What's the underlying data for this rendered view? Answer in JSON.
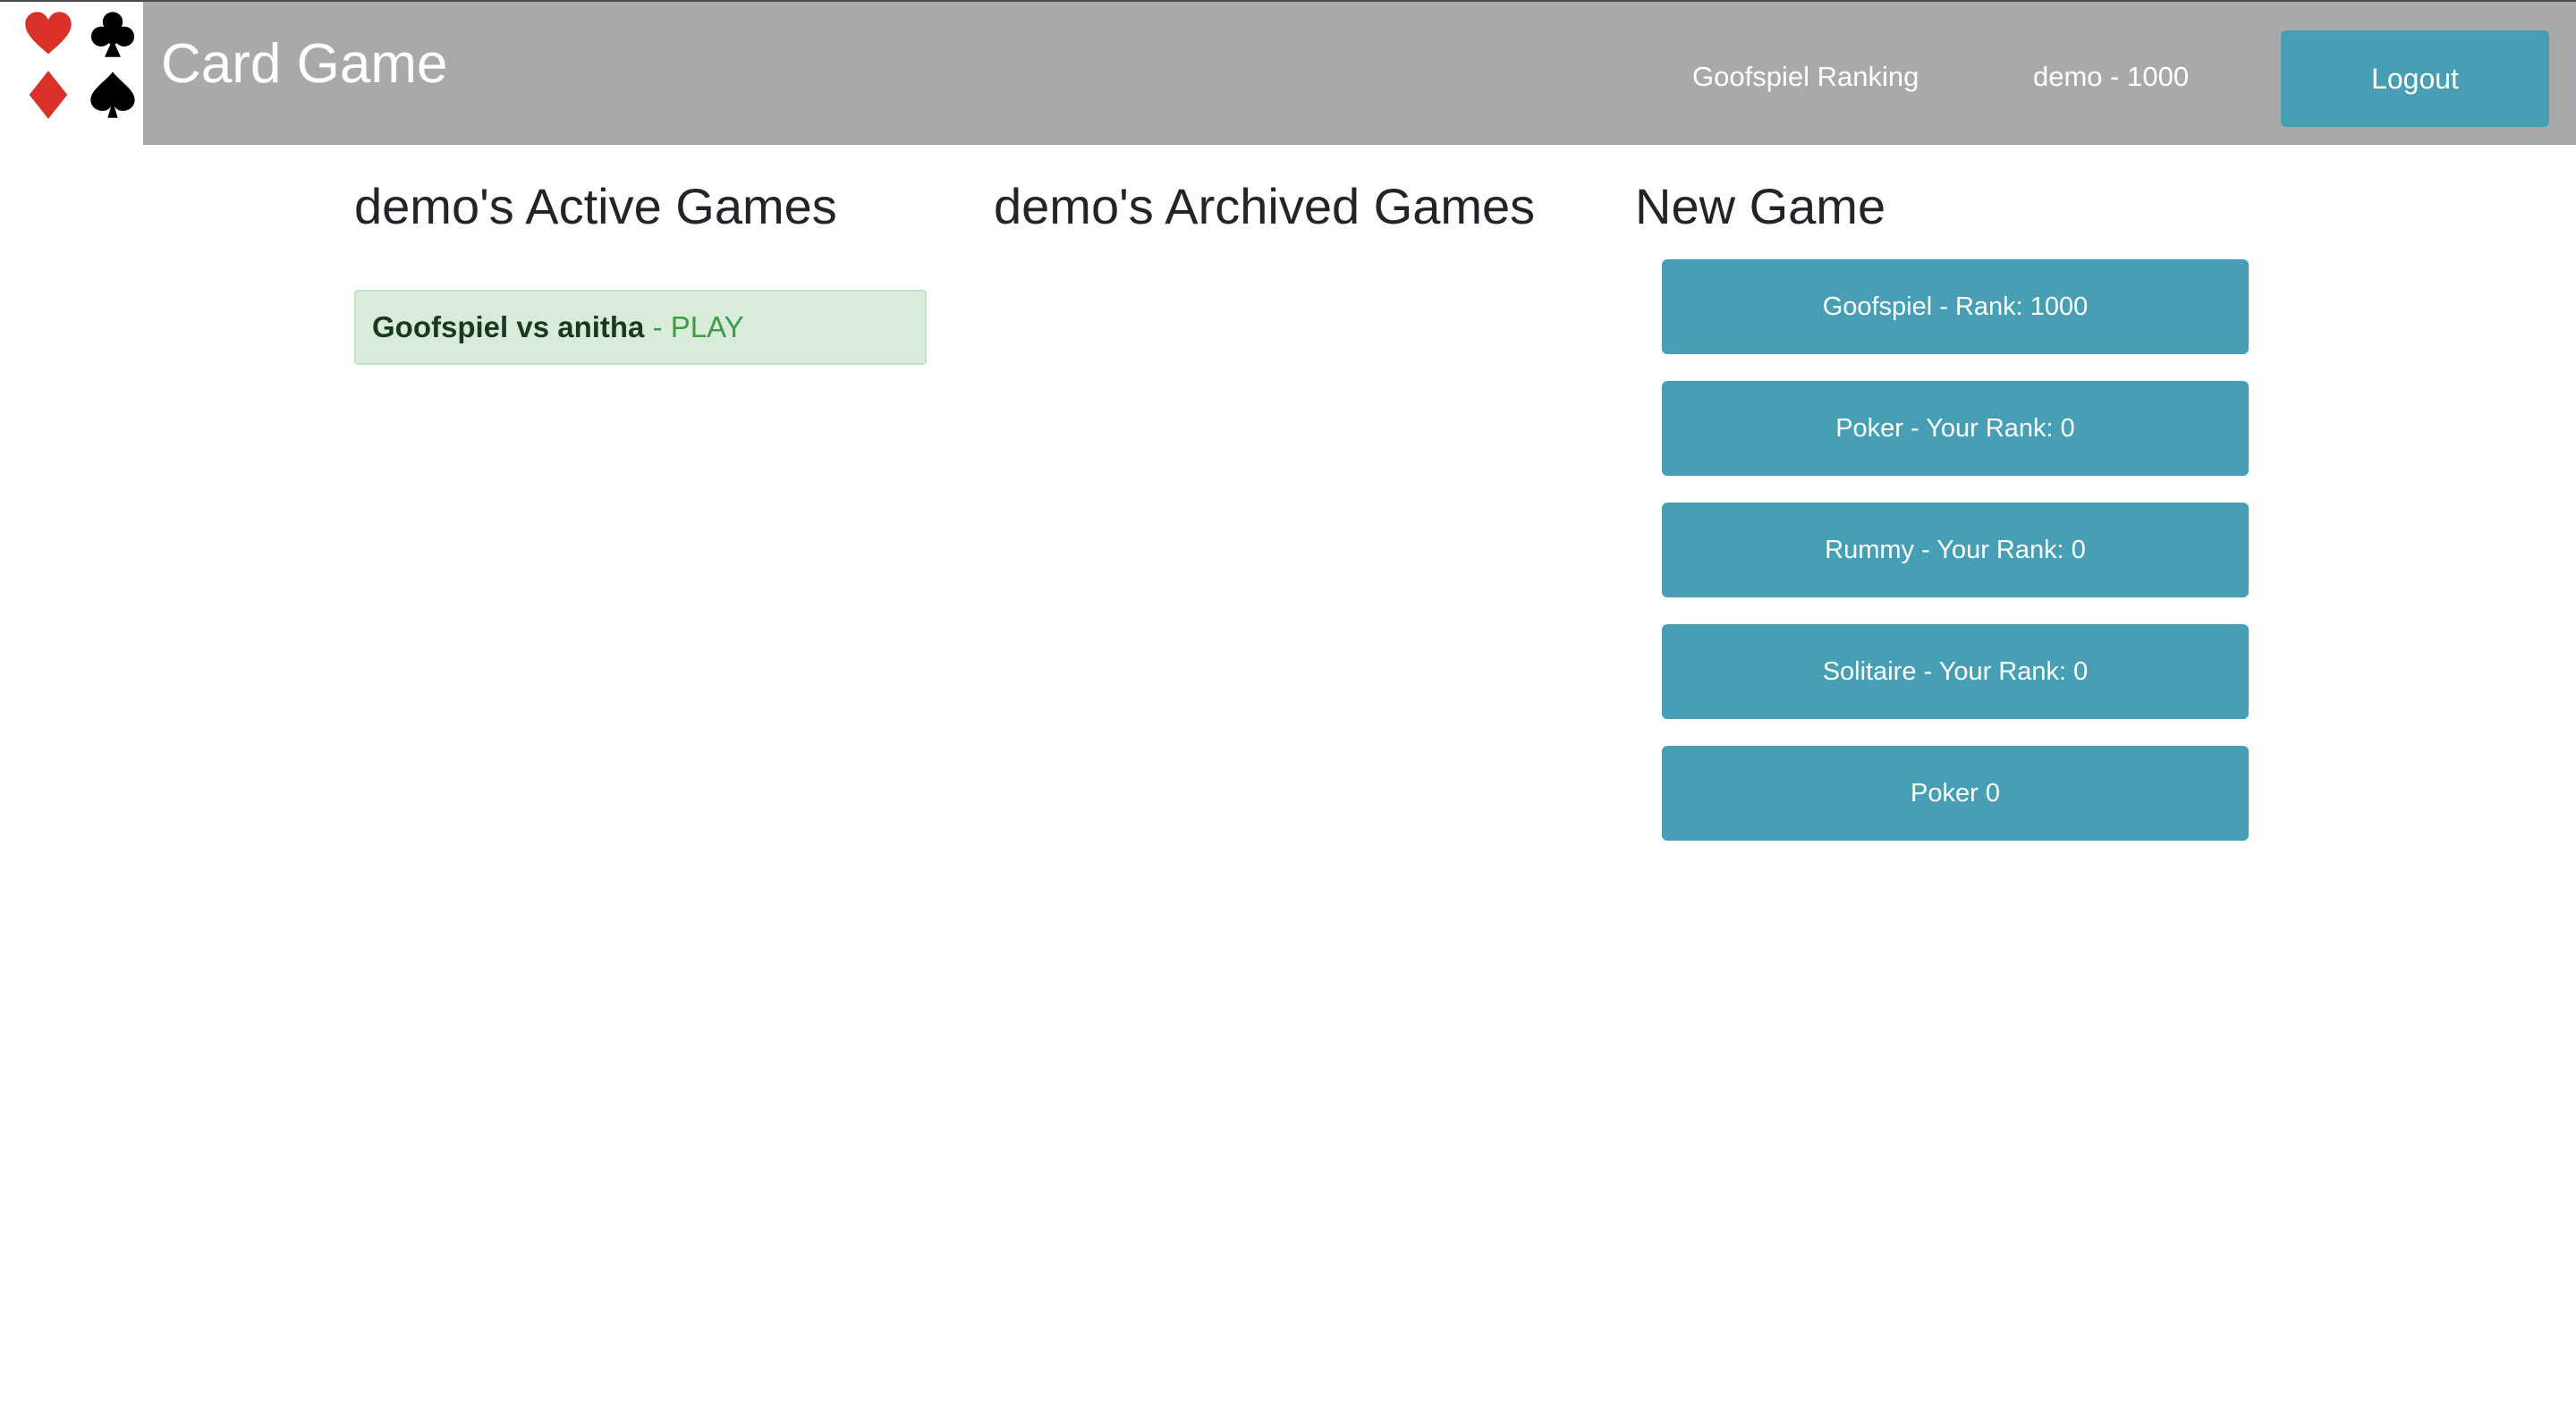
{
  "navbar": {
    "brand": "Card Game",
    "logo_icons": [
      "heart-icon",
      "club-icon",
      "diamond-icon",
      "spade-icon"
    ],
    "ranking_link": "Goofspiel Ranking",
    "user_info": "demo - 1000",
    "logout_label": "Logout"
  },
  "columns": {
    "active_title": "demo's Active Games",
    "archived_title": "demo's Archived Games",
    "new_title": "New Game"
  },
  "active_games": [
    {
      "name": "Goofspiel vs anitha",
      "separator": " - ",
      "action": "PLAY"
    }
  ],
  "new_game_buttons": [
    "Goofspiel - Rank: 1000",
    "Poker - Your Rank: 0",
    "Rummy - Your Rank: 0",
    "Solitaire - Your Rank: 0",
    "Poker 0"
  ],
  "colors": {
    "navbar_bg": "#a9a9a9",
    "button_bg": "#469fb4",
    "active_game_bg": "#d9ecdb",
    "play_text": "#3f9c44",
    "heart_diamond": "#d9302a",
    "club_spade": "#000000"
  }
}
